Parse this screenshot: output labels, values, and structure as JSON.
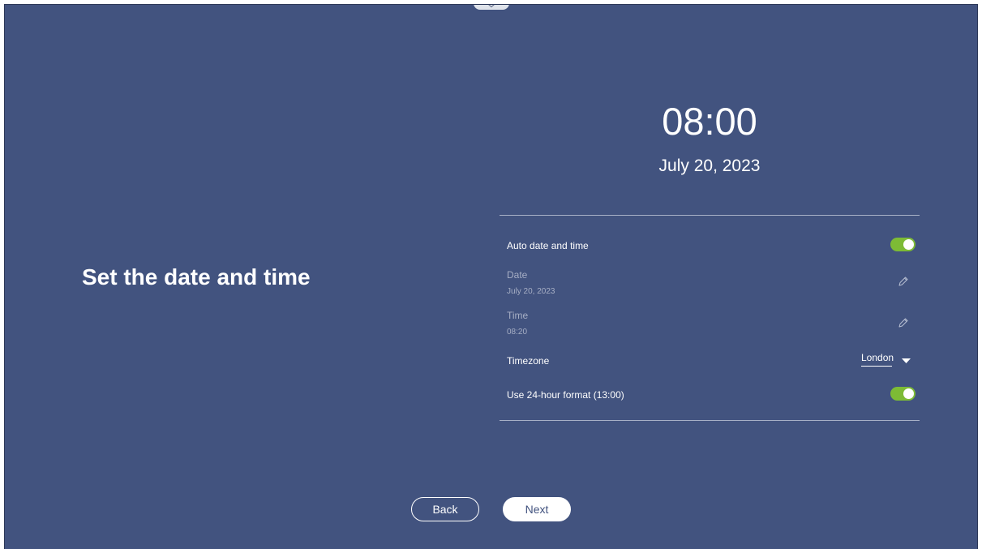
{
  "colors": {
    "background": "#42537f",
    "toggle_on": "#7dbb35",
    "text": "#ffffff",
    "dim_text": "#a6aec4"
  },
  "page": {
    "heading": "Set the date and time"
  },
  "clock": {
    "time": "08:00",
    "date": "July 20, 2023"
  },
  "settings": {
    "auto_date_time": {
      "label": "Auto date and time",
      "enabled": true
    },
    "date": {
      "label": "Date",
      "value": "July 20, 2023",
      "icon": "pencil-icon"
    },
    "time": {
      "label": "Time",
      "value": "08:20",
      "icon": "pencil-icon"
    },
    "timezone": {
      "label": "Timezone",
      "value": "London",
      "icon": "dropdown-arrow-icon"
    },
    "hour24": {
      "label": "Use 24-hour format (13:00)",
      "enabled": true
    }
  },
  "buttons": {
    "back": "Back",
    "next": "Next"
  }
}
